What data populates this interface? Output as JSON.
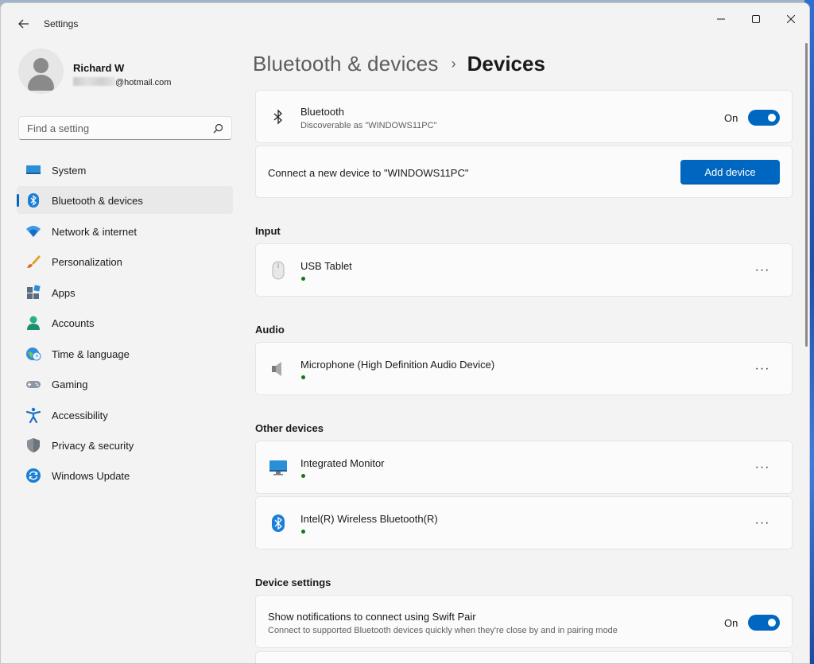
{
  "window": {
    "title": "Settings",
    "back_icon": "back-arrow-icon",
    "controls": {
      "minimize_icon": "minimize-icon",
      "maximize_icon": "maximize-icon",
      "close_icon": "close-icon"
    }
  },
  "profile": {
    "name": "Richard W",
    "email_visible": "@hotmail.com"
  },
  "search": {
    "placeholder": "Find a setting",
    "icon": "search-icon"
  },
  "sidebar": {
    "items": [
      {
        "label": "System",
        "icon": "system-icon",
        "active": false
      },
      {
        "label": "Bluetooth & devices",
        "icon": "bluetooth-icon",
        "active": true
      },
      {
        "label": "Network & internet",
        "icon": "wifi-icon",
        "active": false
      },
      {
        "label": "Personalization",
        "icon": "brush-icon",
        "active": false
      },
      {
        "label": "Apps",
        "icon": "apps-icon",
        "active": false
      },
      {
        "label": "Accounts",
        "icon": "accounts-icon",
        "active": false
      },
      {
        "label": "Time & language",
        "icon": "globe-clock-icon",
        "active": false
      },
      {
        "label": "Gaming",
        "icon": "gamepad-icon",
        "active": false
      },
      {
        "label": "Accessibility",
        "icon": "accessibility-icon",
        "active": false
      },
      {
        "label": "Privacy & security",
        "icon": "shield-icon",
        "active": false
      },
      {
        "label": "Windows Update",
        "icon": "update-icon",
        "active": false
      }
    ]
  },
  "breadcrumb": {
    "parent": "Bluetooth & devices",
    "separator": "›",
    "current": "Devices"
  },
  "bluetooth": {
    "title": "Bluetooth",
    "subtitle": "Discoverable as \"WINDOWS11PC\"",
    "state_label": "On",
    "enabled": true
  },
  "add_device": {
    "label": "Connect a new device to \"WINDOWS11PC\"",
    "button": "Add device"
  },
  "sections": {
    "input": {
      "title": "Input",
      "devices": [
        {
          "name": "USB Tablet",
          "icon": "mouse-icon",
          "connected": true
        }
      ]
    },
    "audio": {
      "title": "Audio",
      "devices": [
        {
          "name": "Microphone (High Definition Audio Device)",
          "icon": "speaker-icon",
          "connected": true
        }
      ]
    },
    "other": {
      "title": "Other devices",
      "devices": [
        {
          "name": "Integrated Monitor",
          "icon": "monitor-icon",
          "connected": true
        },
        {
          "name": "Intel(R) Wireless Bluetooth(R)",
          "icon": "bluetooth-icon",
          "connected": true
        }
      ]
    },
    "device_settings": {
      "title": "Device settings",
      "swift_pair": {
        "title": "Show notifications to connect using Swift Pair",
        "subtitle": "Connect to supported Bluetooth devices quickly when they're close by and in pairing mode",
        "state_label": "On",
        "enabled": true
      }
    }
  },
  "more_label": "···",
  "colors": {
    "accent": "#0067c0",
    "connected": "#0f7b0f",
    "window_bg": "#f3f3f3",
    "card_bg": "#fbfbfb"
  }
}
